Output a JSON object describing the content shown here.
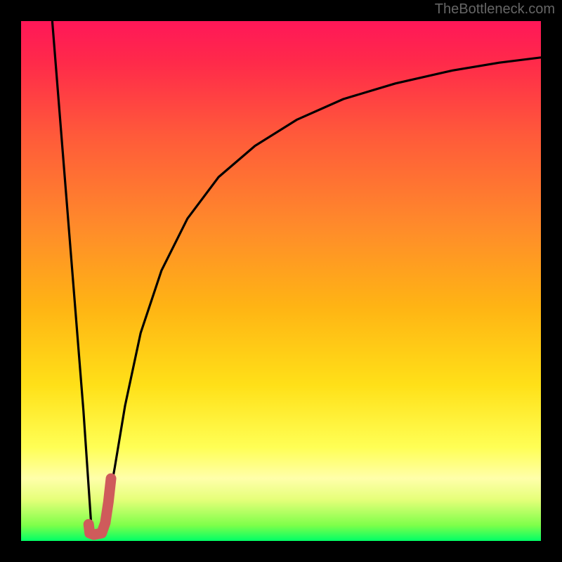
{
  "watermark": "TheBottleneck.com",
  "chart_data": {
    "type": "line",
    "title": "",
    "xlabel": "",
    "ylabel": "",
    "xlim": [
      0,
      100
    ],
    "ylim": [
      0,
      100
    ],
    "gradient_stops": [
      {
        "pos": 0.0,
        "color": "#00ff66"
      },
      {
        "pos": 0.03,
        "color": "#7eff4a"
      },
      {
        "pos": 0.08,
        "color": "#e6ff7a"
      },
      {
        "pos": 0.12,
        "color": "#ffffaa"
      },
      {
        "pos": 0.18,
        "color": "#ffff55"
      },
      {
        "pos": 0.3,
        "color": "#ffe018"
      },
      {
        "pos": 0.45,
        "color": "#ffb414"
      },
      {
        "pos": 0.6,
        "color": "#ff8c2a"
      },
      {
        "pos": 0.78,
        "color": "#ff5a3a"
      },
      {
        "pos": 0.92,
        "color": "#ff2a4a"
      },
      {
        "pos": 1.0,
        "color": "#ff1758"
      }
    ],
    "series": [
      {
        "name": "left-branch",
        "x": [
          6,
          8,
          10,
          12,
          13.5
        ],
        "y": [
          100,
          75,
          50,
          25,
          3
        ],
        "stroke": "#000000",
        "width": 3.2
      },
      {
        "name": "right-branch",
        "x": [
          16,
          18,
          20,
          23,
          27,
          32,
          38,
          45,
          53,
          62,
          72,
          83,
          92,
          100
        ],
        "y": [
          3,
          14,
          26,
          40,
          52,
          62,
          70,
          76,
          81,
          85,
          88,
          90.5,
          92,
          93
        ],
        "stroke": "#000000",
        "width": 3.2
      },
      {
        "name": "j-mark",
        "x": [
          13,
          13.2,
          14,
          15.5,
          16.2,
          16.8,
          17.3
        ],
        "y": [
          3.2,
          1.5,
          1.2,
          1.5,
          3.5,
          7.5,
          12
        ],
        "stroke": "#cf5b5b",
        "width": 15,
        "linecap": "round"
      }
    ]
  }
}
